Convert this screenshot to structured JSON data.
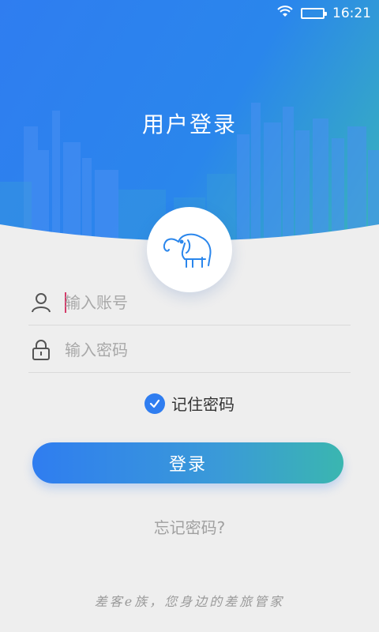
{
  "status_bar": {
    "time": "16:21",
    "icons": [
      "wifi-icon",
      "battery-icon"
    ]
  },
  "header": {
    "title": "用户登录"
  },
  "logo": {
    "icon": "elephant-icon"
  },
  "form": {
    "account": {
      "placeholder": "输入账号",
      "value": "",
      "icon": "user-icon"
    },
    "password": {
      "placeholder": "输入密码",
      "value": "",
      "icon": "lock-icon"
    },
    "remember": {
      "label": "记住密码",
      "checked": true
    }
  },
  "actions": {
    "login_label": "登录",
    "forgot_label": "忘记密码?"
  },
  "footer": {
    "slogan": "差客e族，您身边的差旅管家"
  },
  "colors": {
    "primary": "#2f7df0",
    "accent": "#3ab6b0",
    "background": "#eeeeee"
  }
}
